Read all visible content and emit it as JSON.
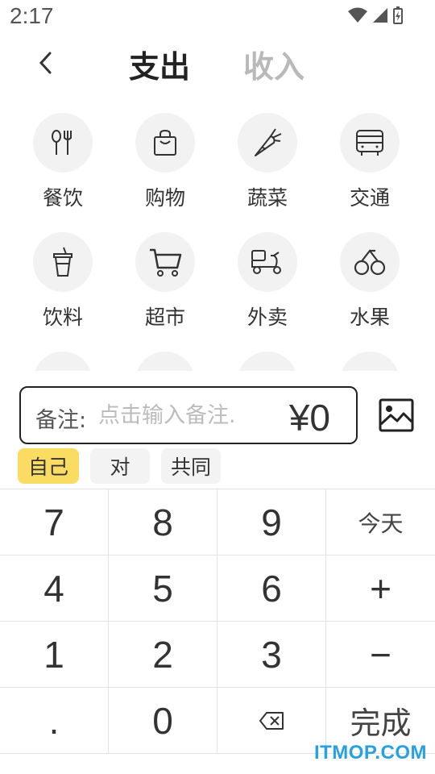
{
  "status": {
    "time": "2:17"
  },
  "header": {
    "tab_expense": "支出",
    "tab_income": "收入"
  },
  "categories": [
    {
      "label": "餐饮",
      "icon": "utensils-icon"
    },
    {
      "label": "购物",
      "icon": "shopping-bag-icon"
    },
    {
      "label": "蔬菜",
      "icon": "carrot-icon"
    },
    {
      "label": "交通",
      "icon": "bus-icon"
    },
    {
      "label": "饮料",
      "icon": "drink-cup-icon"
    },
    {
      "label": "超市",
      "icon": "cart-icon"
    },
    {
      "label": "外卖",
      "icon": "delivery-scooter-icon"
    },
    {
      "label": "水果",
      "icon": "cherry-icon"
    }
  ],
  "note": {
    "label": "备注:",
    "placeholder": "点击输入备注.",
    "amount": "¥0"
  },
  "payers": [
    {
      "label": "自己",
      "active": true
    },
    {
      "label": "对",
      "active": false
    },
    {
      "label": "共同",
      "active": false
    }
  ],
  "keypad": {
    "k7": "7",
    "k8": "8",
    "k9": "9",
    "today": "今天",
    "k4": "4",
    "k5": "5",
    "k6": "6",
    "plus": "+",
    "k1": "1",
    "k2": "2",
    "k3": "3",
    "minus": "−",
    "dot": ".",
    "k0": "0",
    "done": "完成"
  },
  "watermark": "ITMOP.COM",
  "colors": {
    "accent": "#fadc62",
    "inactive_tab": "#b9b9b9",
    "watermark": "#27a1e0"
  }
}
